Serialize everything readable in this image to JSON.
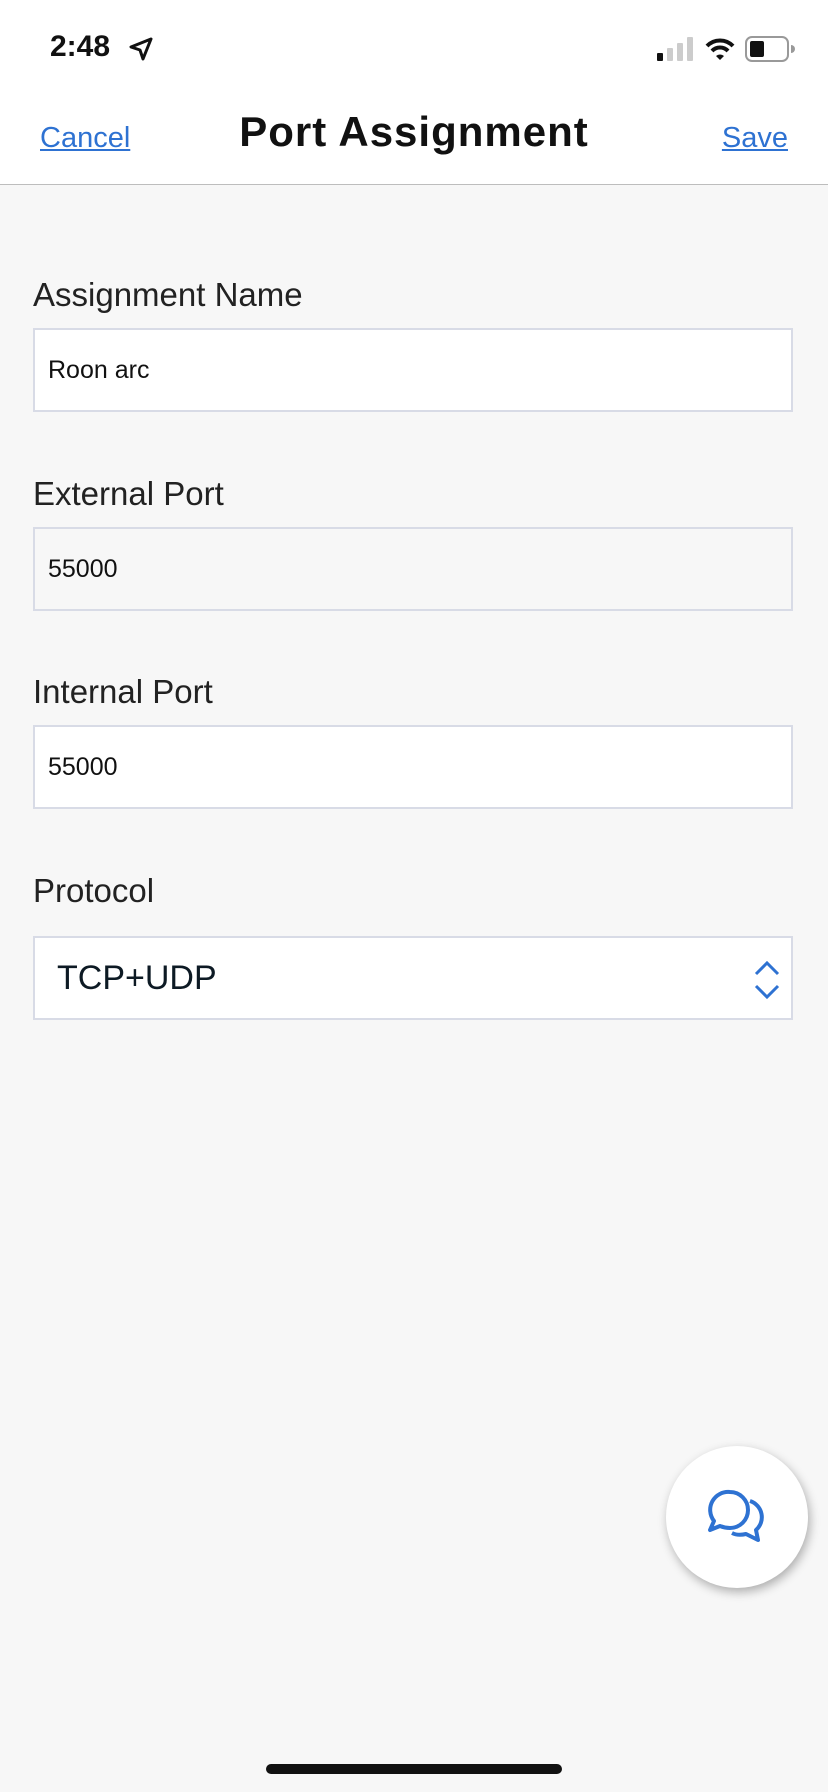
{
  "status_bar": {
    "time": "2:48",
    "icons": [
      "location-arrow-icon",
      "signal-icon",
      "wifi-icon",
      "battery-icon"
    ]
  },
  "nav": {
    "cancel_label": "Cancel",
    "title": "Port Assignment",
    "save_label": "Save"
  },
  "form": {
    "assignment_name": {
      "label": "Assignment Name",
      "value": "Roon arc"
    },
    "external_port": {
      "label": "External Port",
      "value": "55000"
    },
    "internal_port": {
      "label": "Internal Port",
      "value": "55000"
    },
    "protocol": {
      "label": "Protocol",
      "value": "TCP+UDP"
    }
  },
  "chat_button": {
    "icon": "chat-bubbles-icon"
  },
  "colors": {
    "accent": "#2e72d2",
    "background": "#f7f7f7",
    "border": "#d8dbe6"
  }
}
